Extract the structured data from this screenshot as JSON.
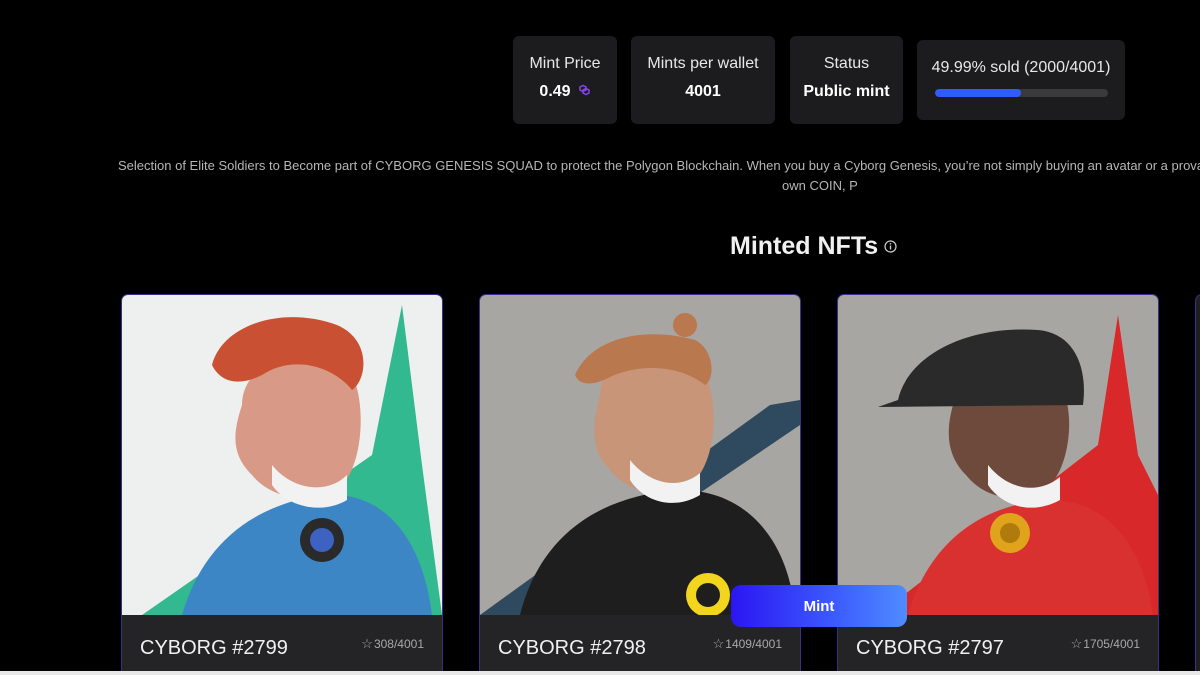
{
  "stats": {
    "mint_price_label": "Mint Price",
    "mint_price_value": "0.49",
    "mints_per_wallet_label": "Mints per wallet",
    "mints_per_wallet_value": "4001",
    "status_label": "Status",
    "status_value": "Public mint",
    "sold_text": "49.99% sold (2000/4001)",
    "sold_fraction": 0.4999
  },
  "description": {
    "line1": "Selection of Elite Soldiers to Become part of CYBORG GENESIS SQUAD to protect the Polygon Blockchain. When you buy a Cyborg Genesis, you’re not simply buying an avatar or a provably",
    "line2": "own COIN, P"
  },
  "section": {
    "title": "Minted NFTs"
  },
  "nfts": [
    {
      "name": "CYBORG #2799",
      "rank": "308/4001",
      "bg": "#eef0f0",
      "hair": "#c95032",
      "skin": "#d89a86",
      "weapon": "#28b58a",
      "jacket": "#3d86c6"
    },
    {
      "name": "CYBORG #2798",
      "rank": "1409/4001",
      "bg": "#a8a6a3",
      "hair": "#b9784e",
      "skin": "#c99579",
      "weapon": "#2f4a5e",
      "jacket": "#1e1e1e"
    },
    {
      "name": "CYBORG #2797",
      "rank": "1705/4001",
      "bg": "#a8a6a3",
      "hair": "#2a2a2a",
      "skin": "#6e4a3c",
      "weapon": "#d9282a",
      "jacket": "#d93030"
    }
  ],
  "mint_button": {
    "label": "Mint"
  },
  "colors": {
    "accent": "#2f5bff",
    "card_border": "#3a2f86",
    "polygon": "#8247e5"
  }
}
